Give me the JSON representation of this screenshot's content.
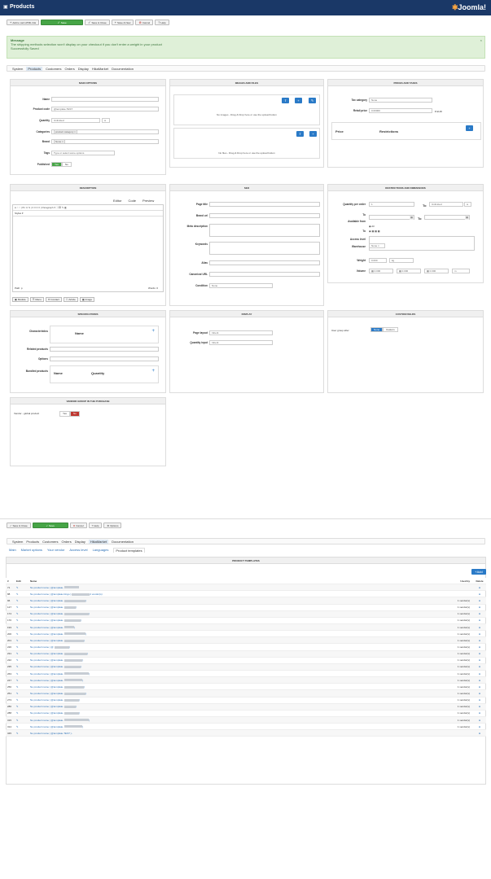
{
  "app": {
    "title": "Products",
    "logo": "Joomla!"
  },
  "toolbar": {
    "add_cart": "Add to cart HTML link",
    "save": "Save",
    "save_close": "Save & Close",
    "save_new": "Save & New",
    "cancel": "Cancel",
    "help": "Help"
  },
  "message": {
    "title": "Message",
    "line1": "The shipping methods selection won't display on your checkout if you don't enter a weight in your product",
    "line2": "Successfully Saved",
    "close": "×"
  },
  "nav": [
    "System",
    "Products",
    "Customers",
    "Orders",
    "Display",
    "HikaMarket",
    "Documentation"
  ],
  "main": {
    "title": "MAIN OPTIONS",
    "name_label": "Name",
    "code_label": "Product code",
    "code_val": "@template-TEST",
    "qty_label": "Quantity",
    "qty_val": "Unlimited",
    "qty_inf": "∞",
    "cat_label": "Categories",
    "cat_val": "product category ×",
    "brand_label": "Brand",
    "brand_val": "None ×",
    "tags_label": "Tags",
    "tags_ph": "Type or select some options",
    "pub_label": "Published",
    "yes": "Yes",
    "no": "No"
  },
  "images": {
    "title": "IMAGES AND FILES",
    "img_text": "No images - Drag & Drop here or use the upload button",
    "file_text": "No files - Drag & Drop here or use the upload button"
  },
  "prices": {
    "title": "PRICES AND TAXES",
    "tax_label": "Tax category",
    "tax_val": "None",
    "retail_label": "Retail price",
    "retail_val": "0.00000",
    "currency": "€ EUR",
    "col_price": "Price",
    "col_restr": "Restrictions"
  },
  "description": {
    "title": "DESCRIPTION",
    "tabs": [
      "Editor",
      "Code",
      "Preview"
    ],
    "para": "Paragraph",
    "styles": "Styles",
    "path": "Path: p",
    "words": "Words: 0",
    "buttons": [
      "Module",
      "Menu",
      "Contact",
      "Article",
      "Image"
    ]
  },
  "seo": {
    "title": "SEO",
    "page_title": "Page title",
    "brand_url": "Brand url",
    "meta": "Meta description",
    "keywords": "Keywords",
    "alias": "Alias",
    "canonical": "Canonical URL",
    "condition": "Condition",
    "cond_val": "None"
  },
  "restrictions": {
    "title": "RESTRICTIONS AND DIMENSIONS",
    "qpo": "Quantity per order",
    "qpo_val": "1",
    "to": "To",
    "unlimited": "Unlimited",
    "to2": "To",
    "avail": "Available from",
    "to3": "To",
    "all": "All",
    "access": "Access level",
    "warehouse": "Warehouse",
    "wh_val": "None ×",
    "weight": "Weight",
    "weight_val": "0.000",
    "kg": "kg",
    "volume": "Volume",
    "v1": "0.000",
    "v2": "0.000",
    "v3": "0.000",
    "m": "m"
  },
  "specs": {
    "title": "SPECIFICATIONS",
    "char": "Characteristics",
    "name": "Name",
    "related": "Related products",
    "options": "Options",
    "bundled": "Bundled products",
    "col_name": "Name",
    "col_qty": "Quantity"
  },
  "display": {
    "title": "DISPLAY",
    "layout": "Page layout",
    "layout_val": "Inherit",
    "qty_input": "Quantity input",
    "qty_val": "Inherit"
  },
  "custom": {
    "title": "CUSTOM FIELDS",
    "user_group": "User group after",
    "none": "None",
    "custom": "Custom"
  },
  "vendor": {
    "title": "VENDOR GROUP IN THE PURCHASE",
    "label": "Vendor - global product",
    "yes": "Yes",
    "no": "No"
  },
  "toolbar2": {
    "save_close": "Save & Close",
    "save": "Save",
    "cancel": "Cancel",
    "help": "Help",
    "options": "Options"
  },
  "tabs2": [
    "Main",
    "Market options",
    "Your vendor",
    "Access level",
    "Languages",
    "Product templates"
  ],
  "templates": {
    "title": "PRODUCT TEMPLATES",
    "add": "Add",
    "cols": [
      "#",
      "Edit",
      "Name",
      "Used by",
      "Delete"
    ],
    "rows": [
      [
        "71",
        "No product name ( @template-",
        "",
        ""
      ],
      [
        "88",
        "No product name ( @template-bingo )",
        "2 vendor(s)"
      ],
      [
        "96",
        "No product name ( @template-",
        ")",
        "1 vendor(s)"
      ],
      [
        "127",
        "No product name ( @template-",
        ")",
        "1 vendor(s)"
      ],
      [
        "174",
        "No product name ( @template-",
        ")",
        "1 vendor(s)"
      ],
      [
        "170",
        "No product name ( @template-",
        ")",
        "1 vendor(s)"
      ],
      [
        "193",
        "No product name ( @template-",
        ")",
        "1 vendor(s)"
      ],
      [
        "200",
        "No product name ( @template-",
        ")",
        "1 vendor(s)"
      ],
      [
        "201",
        "No product name ( @template-",
        ")",
        "1 vendor(s)"
      ],
      [
        "220",
        "No product name ( @",
        ")",
        "1 vendor(s)"
      ],
      [
        "231",
        "No product name ( @template-",
        ")",
        "1 vendor(s)"
      ],
      [
        "222",
        "No product name ( @template-",
        ")",
        "1 vendor(s)"
      ],
      [
        "235",
        "No product name ( @template-",
        ")",
        "1 vendor(s)"
      ],
      [
        "263",
        "No product name ( @template-",
        ")",
        "1 vendor(s)"
      ],
      [
        "247",
        "No product name ( @template-",
        ")",
        "1 vendor(s)"
      ],
      [
        "250",
        "No product name ( @template-",
        ")",
        "1 vendor(s)"
      ],
      [
        "251",
        "No product name ( @template-",
        ")",
        "1 vendor(s)"
      ],
      [
        "273",
        "No product name ( @template-",
        ")",
        "1 vendor(s)"
      ],
      [
        "280",
        "No product name ( @template-",
        ")",
        "1 vendor(s)"
      ],
      [
        "288",
        "No product name ( @template-",
        ")",
        "1 vendor(s)"
      ],
      [
        "315",
        "No product name ( @template-",
        ")",
        "1 vendor(s)"
      ],
      [
        "314",
        "No product name ( @template-",
        ")",
        "1 vendor(s)"
      ],
      [
        "345",
        "No product name ( @template-TEST )",
        "-"
      ]
    ]
  }
}
